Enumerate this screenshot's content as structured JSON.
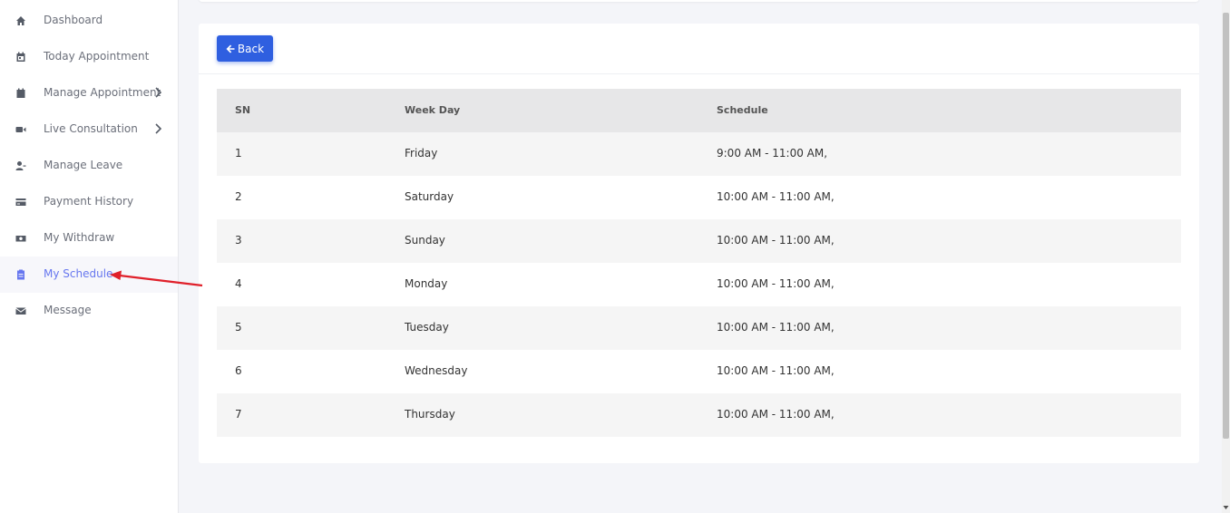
{
  "sidebar": {
    "items": [
      {
        "label": "Dashboard",
        "icon": "home-icon"
      },
      {
        "label": "Today Appointment",
        "icon": "calendar-icon"
      },
      {
        "label": "Manage Appointment",
        "icon": "calendar-icon"
      },
      {
        "label": "Live Consultation",
        "icon": "video-icon"
      },
      {
        "label": "Manage Leave",
        "icon": "user-minus-icon"
      },
      {
        "label": "Payment History",
        "icon": "credit-card-icon"
      },
      {
        "label": "My Withdraw",
        "icon": "money-icon"
      },
      {
        "label": "My Schedule",
        "icon": "clipboard-icon"
      },
      {
        "label": "Message",
        "icon": "envelope-icon"
      }
    ],
    "active_item": "My Schedule"
  },
  "main": {
    "back_label": "Back",
    "table": {
      "headers": [
        "SN",
        "Week Day",
        "Schedule"
      ],
      "rows": [
        {
          "sn": "1",
          "day": "Friday",
          "schedule": "9:00 AM - 11:00 AM,"
        },
        {
          "sn": "2",
          "day": "Saturday",
          "schedule": "10:00 AM - 11:00 AM,"
        },
        {
          "sn": "3",
          "day": "Sunday",
          "schedule": "10:00 AM - 11:00 AM,"
        },
        {
          "sn": "4",
          "day": "Monday",
          "schedule": "10:00 AM - 11:00 AM,"
        },
        {
          "sn": "5",
          "day": "Tuesday",
          "schedule": "10:00 AM - 11:00 AM,"
        },
        {
          "sn": "6",
          "day": "Wednesday",
          "schedule": "10:00 AM - 11:00 AM,"
        },
        {
          "sn": "7",
          "day": "Thursday",
          "schedule": "10:00 AM - 11:00 AM,"
        }
      ]
    }
  },
  "colors": {
    "accent": "#6777ef",
    "button": "#2f5fe0",
    "annotation_arrow": "#e0202a"
  }
}
